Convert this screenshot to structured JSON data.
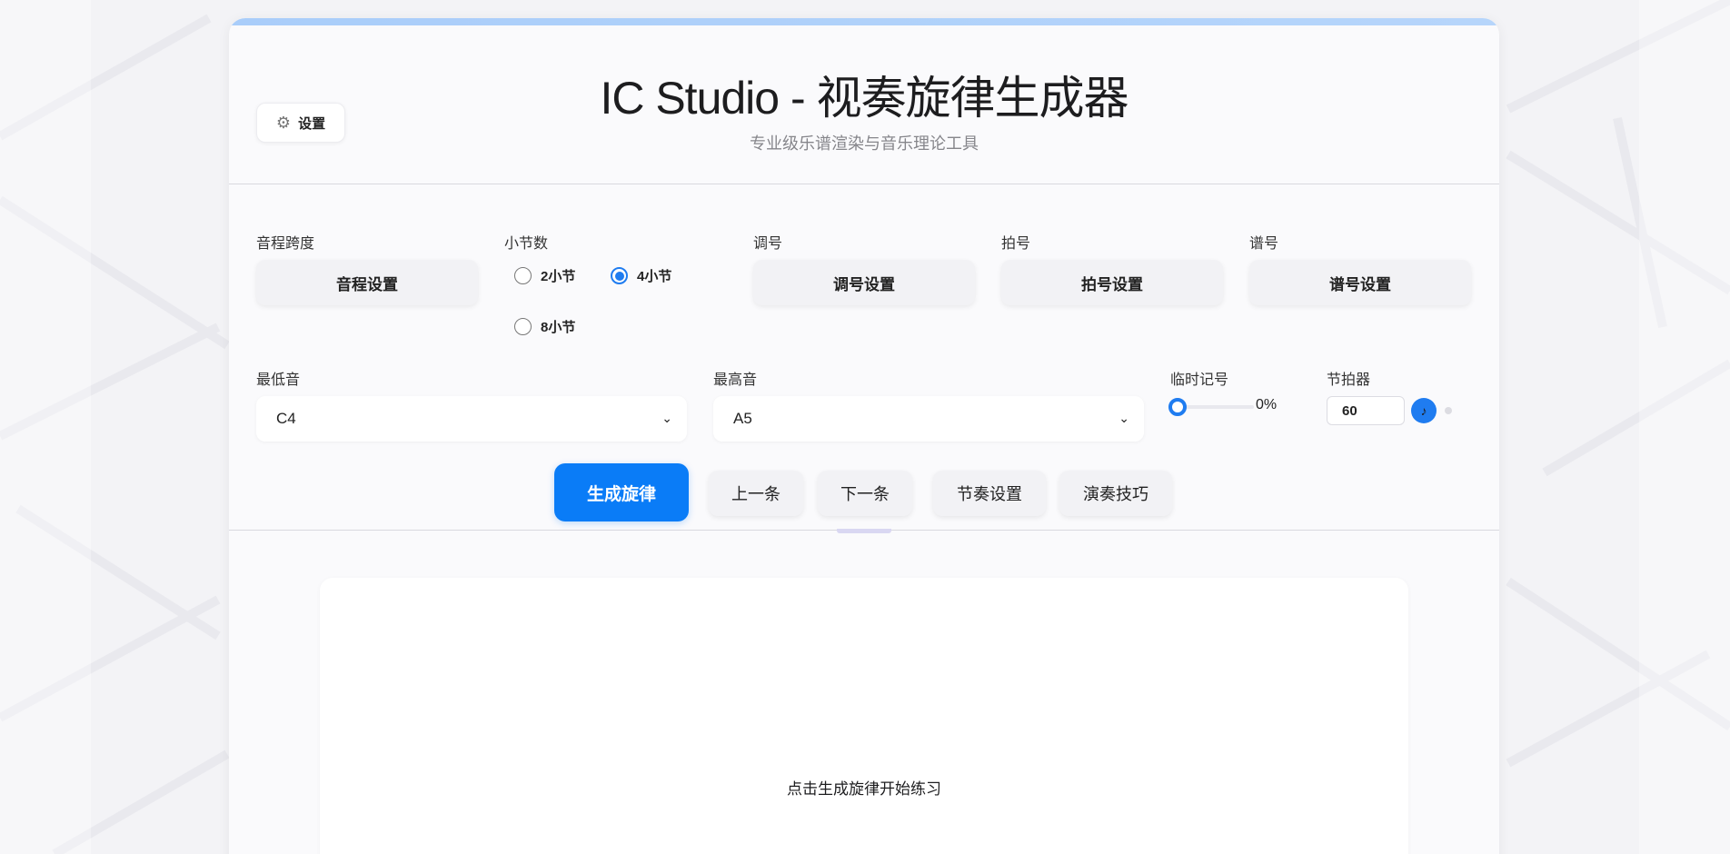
{
  "header": {
    "settings_label": "设置",
    "settings_icon": "gear-icon",
    "title": "IC Studio - 视奏旋律生成器",
    "subtitle": "专业级乐谱渲染与音乐理论工具"
  },
  "controls": {
    "interval": {
      "label": "音程跨度",
      "button": "音程设置"
    },
    "measures": {
      "label": "小节数",
      "options": [
        {
          "label": "2小节",
          "selected": false
        },
        {
          "label": "4小节",
          "selected": true
        },
        {
          "label": "8小节",
          "selected": false
        }
      ]
    },
    "key": {
      "label": "调号",
      "button": "调号设置"
    },
    "time": {
      "label": "拍号",
      "button": "拍号设置"
    },
    "clef": {
      "label": "谱号",
      "button": "谱号设置"
    },
    "lowest": {
      "label": "最低音",
      "value": "C4"
    },
    "highest": {
      "label": "最高音",
      "value": "A5"
    },
    "accidentals": {
      "label": "临时记号",
      "value_text": "0%",
      "value": 0
    },
    "metronome": {
      "label": "节拍器",
      "bpm": "60",
      "icon": "music-note-icon"
    }
  },
  "actions": {
    "generate": "生成旋律",
    "prev": "上一条",
    "next": "下一条",
    "rhythm": "节奏设置",
    "technique": "演奏技巧"
  },
  "score": {
    "placeholder": "点击生成旋律开始练习"
  },
  "colors": {
    "accent": "#0a7cf7",
    "background": "#f3f3f6",
    "card": "#fafafc"
  }
}
